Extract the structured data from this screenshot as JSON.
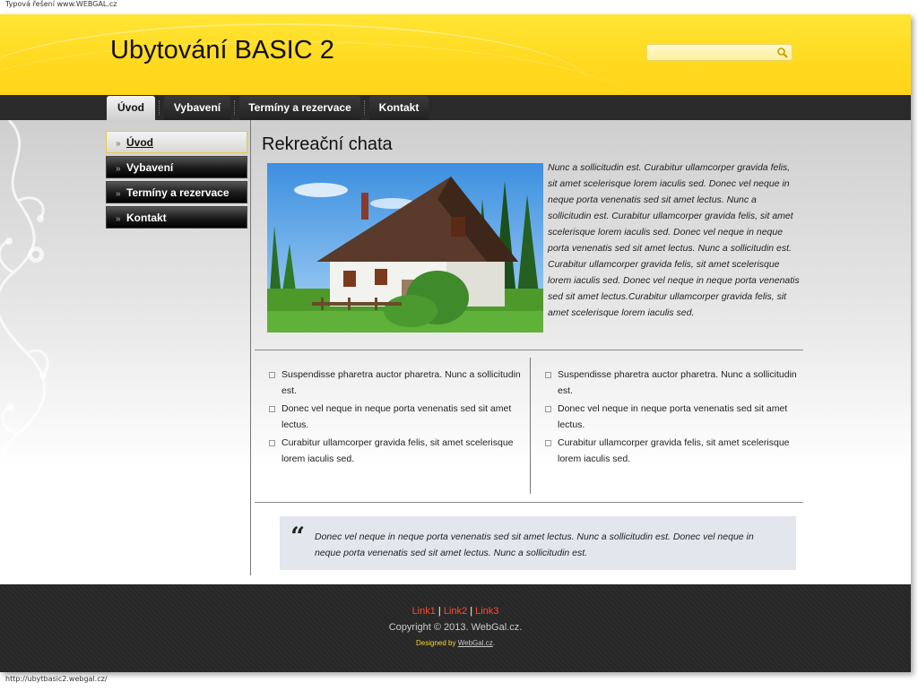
{
  "browser": {
    "top_note": "Typová řešení www.WEBGAL.cz",
    "status_url": "http://ubytbasic2.webgal.cz/"
  },
  "header": {
    "site_title": "Ubytování BASIC 2",
    "search_value": ""
  },
  "nav": {
    "items": [
      {
        "label": "Úvod"
      },
      {
        "label": "Vybavení"
      },
      {
        "label": "Termíny a rezervace"
      },
      {
        "label": "Kontakt"
      }
    ]
  },
  "sidebar": {
    "items": [
      {
        "label": "Úvod"
      },
      {
        "label": "Vybavení"
      },
      {
        "label": "Termíny a rezervace"
      },
      {
        "label": "Kontakt"
      }
    ]
  },
  "content": {
    "title": "Rekreační chata",
    "intro": "Nunc a sollicitudin est. Curabitur ullamcorper gravida felis, sit amet scelerisque lorem iaculis sed. Donec vel neque in neque porta venenatis sed sit amet lectus. Nunc a sollicitudin est. Curabitur ullamcorper gravida felis, sit amet scelerisque lorem iaculis sed. Donec vel neque in neque porta venenatis sed sit amet lectus. Nunc a sollicitudin est. Curabitur ullamcorper gravida felis, sit amet scelerisque lorem iaculis sed. Donec vel neque in neque porta venenatis sed sit amet lectus.Curabitur ullamcorper gravida felis, sit amet scelerisque lorem iaculis sed.",
    "left_list": [
      "Suspendisse pharetra auctor pharetra. Nunc a sollicitudin est.",
      "Donec vel neque in neque porta venenatis sed sit amet lectus.",
      "Curabitur ullamcorper gravida felis, sit amet scelerisque lorem iaculis sed."
    ],
    "right_list": [
      "Suspendisse pharetra auctor pharetra. Nunc a sollicitudin est.",
      "Donec vel neque in neque porta venenatis sed sit amet lectus.",
      "Curabitur ullamcorper gravida felis, sit amet scelerisque lorem iaculis sed."
    ],
    "quote_mark": "“",
    "quote": "Donec vel neque in neque porta venenatis sed sit amet lectus. Nunc a sollicitudin est. Donec vel neque in neque porta venenatis sed sit amet lectus. Nunc a sollicitudin est."
  },
  "footer": {
    "link1": "Link1",
    "link2": "Link2",
    "link3": "Link3",
    "sep": "|",
    "copyright": "Copyright © 2013. WebGal.cz.",
    "designed_by": "Designed by",
    "designer": "WebGal.cz",
    "period": "."
  },
  "colors": {
    "header_yellow": "#ffd920",
    "nav_dark": "#2a2a2a",
    "footer_link_red": "#ff4a2a",
    "footer_design_yellow": "#ffd52a"
  }
}
